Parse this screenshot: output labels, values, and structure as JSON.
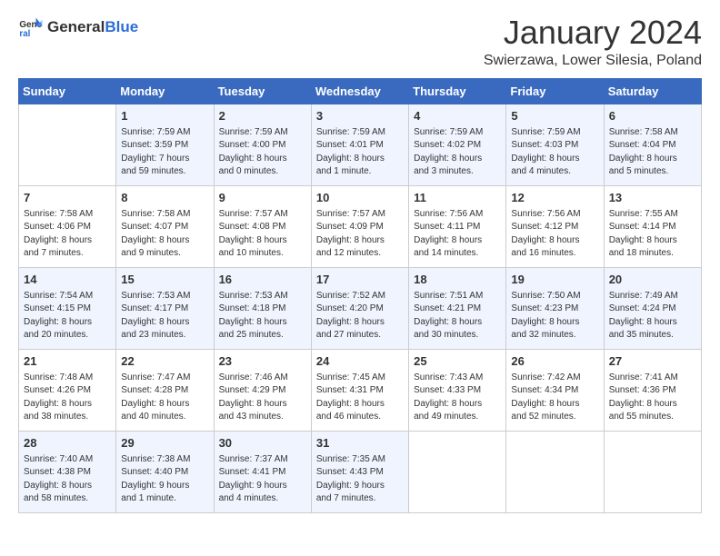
{
  "header": {
    "logo": {
      "text_general": "General",
      "text_blue": "Blue"
    },
    "month": "January 2024",
    "location": "Swierzawa, Lower Silesia, Poland"
  },
  "weekdays": [
    "Sunday",
    "Monday",
    "Tuesday",
    "Wednesday",
    "Thursday",
    "Friday",
    "Saturday"
  ],
  "weeks": [
    [
      {
        "day": "",
        "info": ""
      },
      {
        "day": "1",
        "info": "Sunrise: 7:59 AM\nSunset: 3:59 PM\nDaylight: 7 hours\nand 59 minutes."
      },
      {
        "day": "2",
        "info": "Sunrise: 7:59 AM\nSunset: 4:00 PM\nDaylight: 8 hours\nand 0 minutes."
      },
      {
        "day": "3",
        "info": "Sunrise: 7:59 AM\nSunset: 4:01 PM\nDaylight: 8 hours\nand 1 minute."
      },
      {
        "day": "4",
        "info": "Sunrise: 7:59 AM\nSunset: 4:02 PM\nDaylight: 8 hours\nand 3 minutes."
      },
      {
        "day": "5",
        "info": "Sunrise: 7:59 AM\nSunset: 4:03 PM\nDaylight: 8 hours\nand 4 minutes."
      },
      {
        "day": "6",
        "info": "Sunrise: 7:58 AM\nSunset: 4:04 PM\nDaylight: 8 hours\nand 5 minutes."
      }
    ],
    [
      {
        "day": "7",
        "info": "Sunrise: 7:58 AM\nSunset: 4:06 PM\nDaylight: 8 hours\nand 7 minutes."
      },
      {
        "day": "8",
        "info": "Sunrise: 7:58 AM\nSunset: 4:07 PM\nDaylight: 8 hours\nand 9 minutes."
      },
      {
        "day": "9",
        "info": "Sunrise: 7:57 AM\nSunset: 4:08 PM\nDaylight: 8 hours\nand 10 minutes."
      },
      {
        "day": "10",
        "info": "Sunrise: 7:57 AM\nSunset: 4:09 PM\nDaylight: 8 hours\nand 12 minutes."
      },
      {
        "day": "11",
        "info": "Sunrise: 7:56 AM\nSunset: 4:11 PM\nDaylight: 8 hours\nand 14 minutes."
      },
      {
        "day": "12",
        "info": "Sunrise: 7:56 AM\nSunset: 4:12 PM\nDaylight: 8 hours\nand 16 minutes."
      },
      {
        "day": "13",
        "info": "Sunrise: 7:55 AM\nSunset: 4:14 PM\nDaylight: 8 hours\nand 18 minutes."
      }
    ],
    [
      {
        "day": "14",
        "info": "Sunrise: 7:54 AM\nSunset: 4:15 PM\nDaylight: 8 hours\nand 20 minutes."
      },
      {
        "day": "15",
        "info": "Sunrise: 7:53 AM\nSunset: 4:17 PM\nDaylight: 8 hours\nand 23 minutes."
      },
      {
        "day": "16",
        "info": "Sunrise: 7:53 AM\nSunset: 4:18 PM\nDaylight: 8 hours\nand 25 minutes."
      },
      {
        "day": "17",
        "info": "Sunrise: 7:52 AM\nSunset: 4:20 PM\nDaylight: 8 hours\nand 27 minutes."
      },
      {
        "day": "18",
        "info": "Sunrise: 7:51 AM\nSunset: 4:21 PM\nDaylight: 8 hours\nand 30 minutes."
      },
      {
        "day": "19",
        "info": "Sunrise: 7:50 AM\nSunset: 4:23 PM\nDaylight: 8 hours\nand 32 minutes."
      },
      {
        "day": "20",
        "info": "Sunrise: 7:49 AM\nSunset: 4:24 PM\nDaylight: 8 hours\nand 35 minutes."
      }
    ],
    [
      {
        "day": "21",
        "info": "Sunrise: 7:48 AM\nSunset: 4:26 PM\nDaylight: 8 hours\nand 38 minutes."
      },
      {
        "day": "22",
        "info": "Sunrise: 7:47 AM\nSunset: 4:28 PM\nDaylight: 8 hours\nand 40 minutes."
      },
      {
        "day": "23",
        "info": "Sunrise: 7:46 AM\nSunset: 4:29 PM\nDaylight: 8 hours\nand 43 minutes."
      },
      {
        "day": "24",
        "info": "Sunrise: 7:45 AM\nSunset: 4:31 PM\nDaylight: 8 hours\nand 46 minutes."
      },
      {
        "day": "25",
        "info": "Sunrise: 7:43 AM\nSunset: 4:33 PM\nDaylight: 8 hours\nand 49 minutes."
      },
      {
        "day": "26",
        "info": "Sunrise: 7:42 AM\nSunset: 4:34 PM\nDaylight: 8 hours\nand 52 minutes."
      },
      {
        "day": "27",
        "info": "Sunrise: 7:41 AM\nSunset: 4:36 PM\nDaylight: 8 hours\nand 55 minutes."
      }
    ],
    [
      {
        "day": "28",
        "info": "Sunrise: 7:40 AM\nSunset: 4:38 PM\nDaylight: 8 hours\nand 58 minutes."
      },
      {
        "day": "29",
        "info": "Sunrise: 7:38 AM\nSunset: 4:40 PM\nDaylight: 9 hours\nand 1 minute."
      },
      {
        "day": "30",
        "info": "Sunrise: 7:37 AM\nSunset: 4:41 PM\nDaylight: 9 hours\nand 4 minutes."
      },
      {
        "day": "31",
        "info": "Sunrise: 7:35 AM\nSunset: 4:43 PM\nDaylight: 9 hours\nand 7 minutes."
      },
      {
        "day": "",
        "info": ""
      },
      {
        "day": "",
        "info": ""
      },
      {
        "day": "",
        "info": ""
      }
    ]
  ]
}
